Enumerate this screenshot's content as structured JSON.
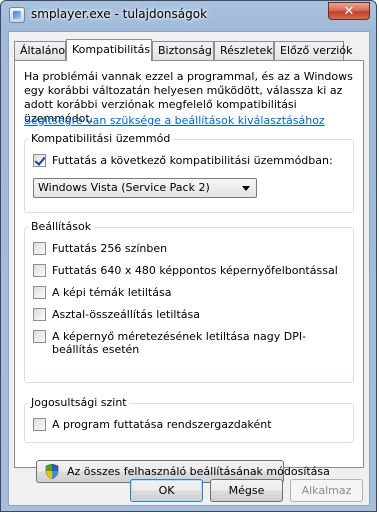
{
  "window": {
    "title": "smplayer.exe - tulajdonságok",
    "close_glyph": "✕"
  },
  "tabs": [
    {
      "label": "Általános"
    },
    {
      "label": "Kompatibilitás",
      "active": true
    },
    {
      "label": "Biztonság"
    },
    {
      "label": "Részletek"
    },
    {
      "label": "Előző verziók"
    }
  ],
  "intro_text": "Ha problémái vannak ezzel a programmal, és az a Windows egy korábbi változatán helyesen működött, válassza ki az adott korábbi verziónak megfelelő kompatibilitási üzemmódot.",
  "help_link": "Segítségre van szüksége a beállítások kiválasztásához",
  "compat_group": {
    "label": "Kompatibilitási üzemmód",
    "checkbox_label": "Futtatás a következő kompatibilitási üzemmódban:",
    "checked": true,
    "selected_mode": "Windows Vista (Service Pack 2)"
  },
  "settings_group": {
    "label": "Beállítások",
    "options": [
      {
        "label": "Futtatás 256 színben",
        "checked": false
      },
      {
        "label": "Futtatás 640 x 480 képpontos képernyőfelbontással",
        "checked": false
      },
      {
        "label": "A képi témák letiltása",
        "checked": false
      },
      {
        "label": "Asztal-összeállítás letiltása",
        "checked": false
      },
      {
        "label": "A képernyő méretezésének letiltása nagy DPI-beállítás esetén",
        "checked": false
      }
    ]
  },
  "privilege_group": {
    "label": "Jogosultsági szint",
    "option_label": "A program futtatása rendszergazdaként",
    "checked": false
  },
  "all_users_button": "Az összes felhasználó beállításának módosítása",
  "buttons": {
    "ok": "OK",
    "cancel": "Mégse",
    "apply": "Alkalmaz"
  },
  "icons": {
    "title": "app-window-icon",
    "close": "close-icon",
    "shield": "uac-shield-icon",
    "dropdown": "chevron-down-icon"
  }
}
